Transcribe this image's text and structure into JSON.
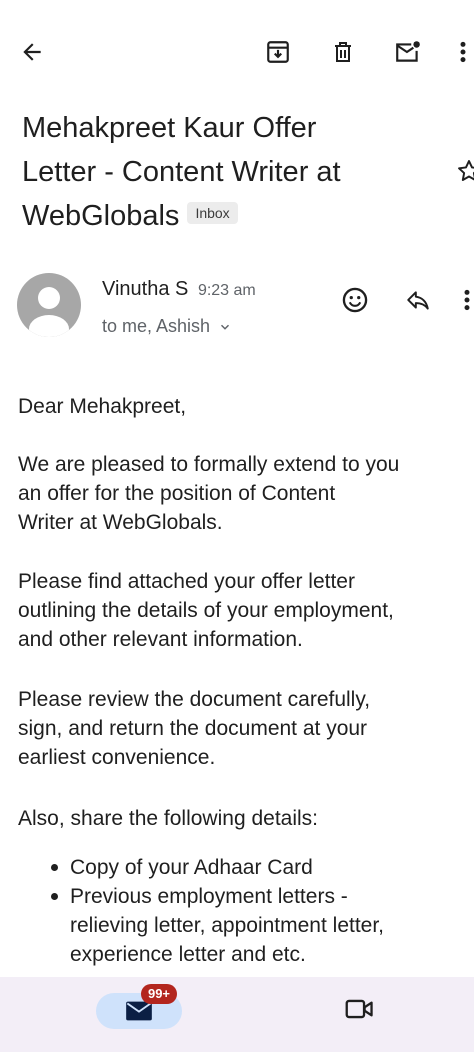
{
  "toolbar": {
    "back_icon": "arrow-left-icon",
    "archive_icon": "archive-icon",
    "delete_icon": "trash-icon",
    "mark_unread_icon": "mail-unread-icon",
    "more_icon": "more-vert-icon"
  },
  "subject": {
    "line1": "Mehakpreet Kaur Offer",
    "line2": "Letter - Content Writer at",
    "line3": "WebGlobals",
    "label": "Inbox"
  },
  "message": {
    "sender": "Vinutha S",
    "time": "9:23 am",
    "recipients": "to me, Ashish"
  },
  "body": {
    "greeting": "Dear Mehakpreet,",
    "p1": [
      "We are pleased to formally extend to you",
      "an offer for the position of Content",
      "Writer at WebGlobals."
    ],
    "p2": [
      "Please find attached your offer letter",
      "outlining the details of your employment,",
      "and other relevant information."
    ],
    "p3": [
      "Please review the document carefully,",
      "sign, and return the document at your",
      "earliest convenience."
    ],
    "p4": "Also, share the following details:",
    "bullet1": "Copy of your Adhaar Card",
    "bullet2": [
      "Previous employment letters -",
      "relieving letter, appointment letter,",
      "experience letter and etc."
    ]
  },
  "bottom_nav": {
    "mail_badge": "99+",
    "mail_icon": "mail-icon",
    "meet_icon": "video-icon"
  },
  "colors": {
    "text": "#1f1f1f",
    "secondary": "#5f6368",
    "nav_bg": "#f3eef7",
    "pill": "#cfe2fb",
    "badge": "#b3261e"
  }
}
